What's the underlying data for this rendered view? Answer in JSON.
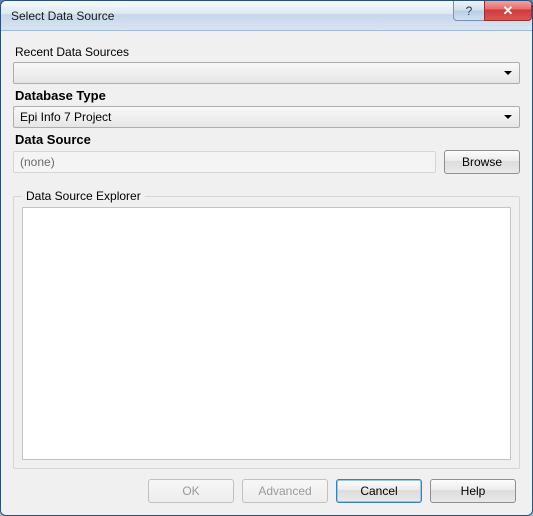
{
  "window": {
    "title": "Select Data Source"
  },
  "titlebar": {
    "help_glyph": "?",
    "close_glyph": "✕"
  },
  "labels": {
    "recent": "Recent Data Sources",
    "db_type": "Database Type",
    "data_source": "Data Source",
    "explorer": "Data Source Explorer"
  },
  "fields": {
    "recent_value": "",
    "db_type_value": "Epi Info 7 Project",
    "data_source_value": "(none)"
  },
  "buttons": {
    "browse": "Browse",
    "ok": "OK",
    "advanced": "Advanced",
    "cancel": "Cancel",
    "help": "Help"
  }
}
